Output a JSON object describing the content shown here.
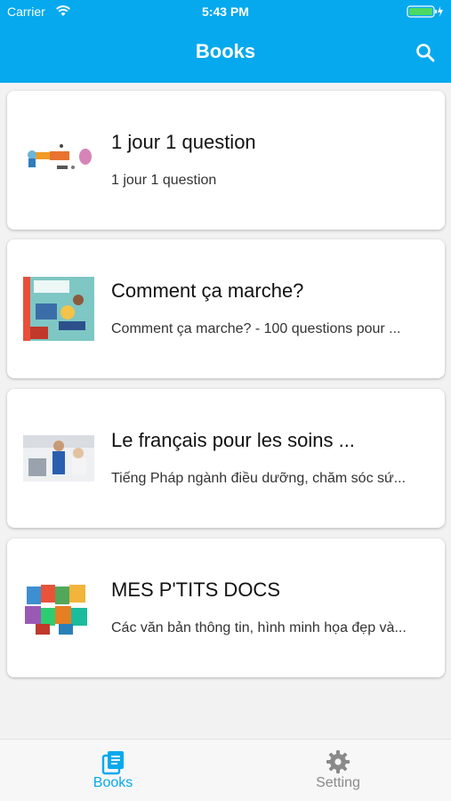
{
  "status": {
    "carrier": "Carrier",
    "time": "5:43 PM"
  },
  "appbar": {
    "title": "Books",
    "search_icon": "search-icon"
  },
  "books": [
    {
      "title": "1 jour 1 question",
      "subtitle": "1 jour 1 question"
    },
    {
      "title": "Comment ça marche?",
      "subtitle": "Comment ça marche? - 100 questions pour ..."
    },
    {
      "title": "Le français pour les soins ...",
      "subtitle": "Tiếng Pháp ngành điều dưỡng, chăm sóc sứ..."
    },
    {
      "title": "MES P'TITS DOCS",
      "subtitle": "Các văn bản thông tin, hình minh họa đẹp và..."
    }
  ],
  "bottom_nav": {
    "books_label": "Books",
    "setting_label": "Setting"
  },
  "colors": {
    "primary": "#06a9ee",
    "inactive": "#8a8a8a",
    "background": "#f2f2f2"
  }
}
